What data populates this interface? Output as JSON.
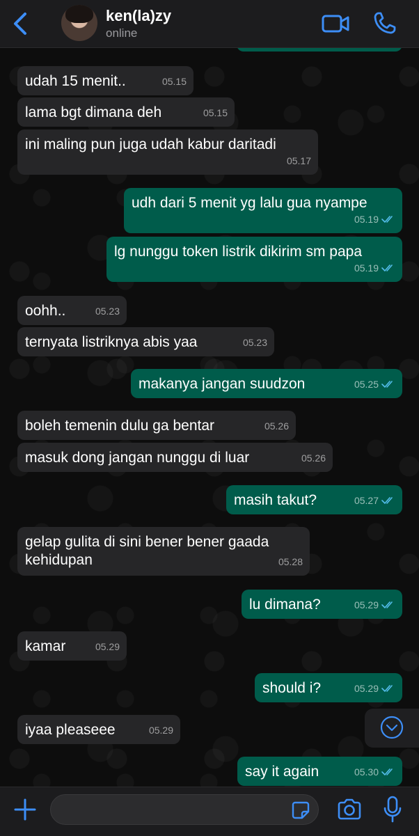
{
  "header": {
    "contact_name": "ken(la)zy",
    "status": "online"
  },
  "messages": [
    {
      "dir": "in",
      "text": "udah 15 menit..",
      "time": "05.15"
    },
    {
      "dir": "in",
      "text": "lama bgt dimana deh",
      "time": "05.15"
    },
    {
      "dir": "in",
      "text": "ini maling pun juga udah kabur daritadi",
      "time": "05.17"
    },
    {
      "dir": "out",
      "text": "udh dari 5 menit yg lalu gua nyampe",
      "time": "05.19",
      "status": "read"
    },
    {
      "dir": "out",
      "text": "lg nunggu token listrik dikirim sm papa",
      "time": "05.19",
      "status": "read"
    },
    {
      "dir": "in",
      "text": "oohh..",
      "time": "05.23"
    },
    {
      "dir": "in",
      "text": "ternyata listriknya abis yaa",
      "time": "05.23"
    },
    {
      "dir": "out",
      "text": "makanya jangan suudzon",
      "time": "05.25",
      "status": "read"
    },
    {
      "dir": "in",
      "text": "boleh temenin dulu ga bentar",
      "time": "05.26"
    },
    {
      "dir": "in",
      "text": "masuk dong jangan nunggu di luar",
      "time": "05.26"
    },
    {
      "dir": "out",
      "text": "masih takut?",
      "time": "05.27",
      "status": "read"
    },
    {
      "dir": "in",
      "text": "gelap gulita di sini bener bener gaada kehidupan",
      "time": "05.28"
    },
    {
      "dir": "out",
      "text": "lu dimana?",
      "time": "05.29",
      "status": "read"
    },
    {
      "dir": "in",
      "text": "kamar",
      "time": "05.29"
    },
    {
      "dir": "out",
      "text": "should i?",
      "time": "05.29",
      "status": "read"
    },
    {
      "dir": "in",
      "text": "iyaa pleaseee",
      "time": "05.29"
    },
    {
      "dir": "out",
      "text": "say it again",
      "time": "05.30",
      "status": "read"
    }
  ],
  "icons": {
    "back": "chevron-left-icon",
    "video": "video-camera-icon",
    "call": "phone-icon",
    "scroll_down": "chevron-down-circle-icon",
    "attach": "plus-icon",
    "sticker": "sticker-icon",
    "camera": "camera-icon",
    "mic": "microphone-icon"
  },
  "colors": {
    "accent": "#3d8ef7",
    "outgoing_bubble": "#005c4b",
    "incoming_bubble": "#262628",
    "read_ticks": "#53bdeb"
  }
}
